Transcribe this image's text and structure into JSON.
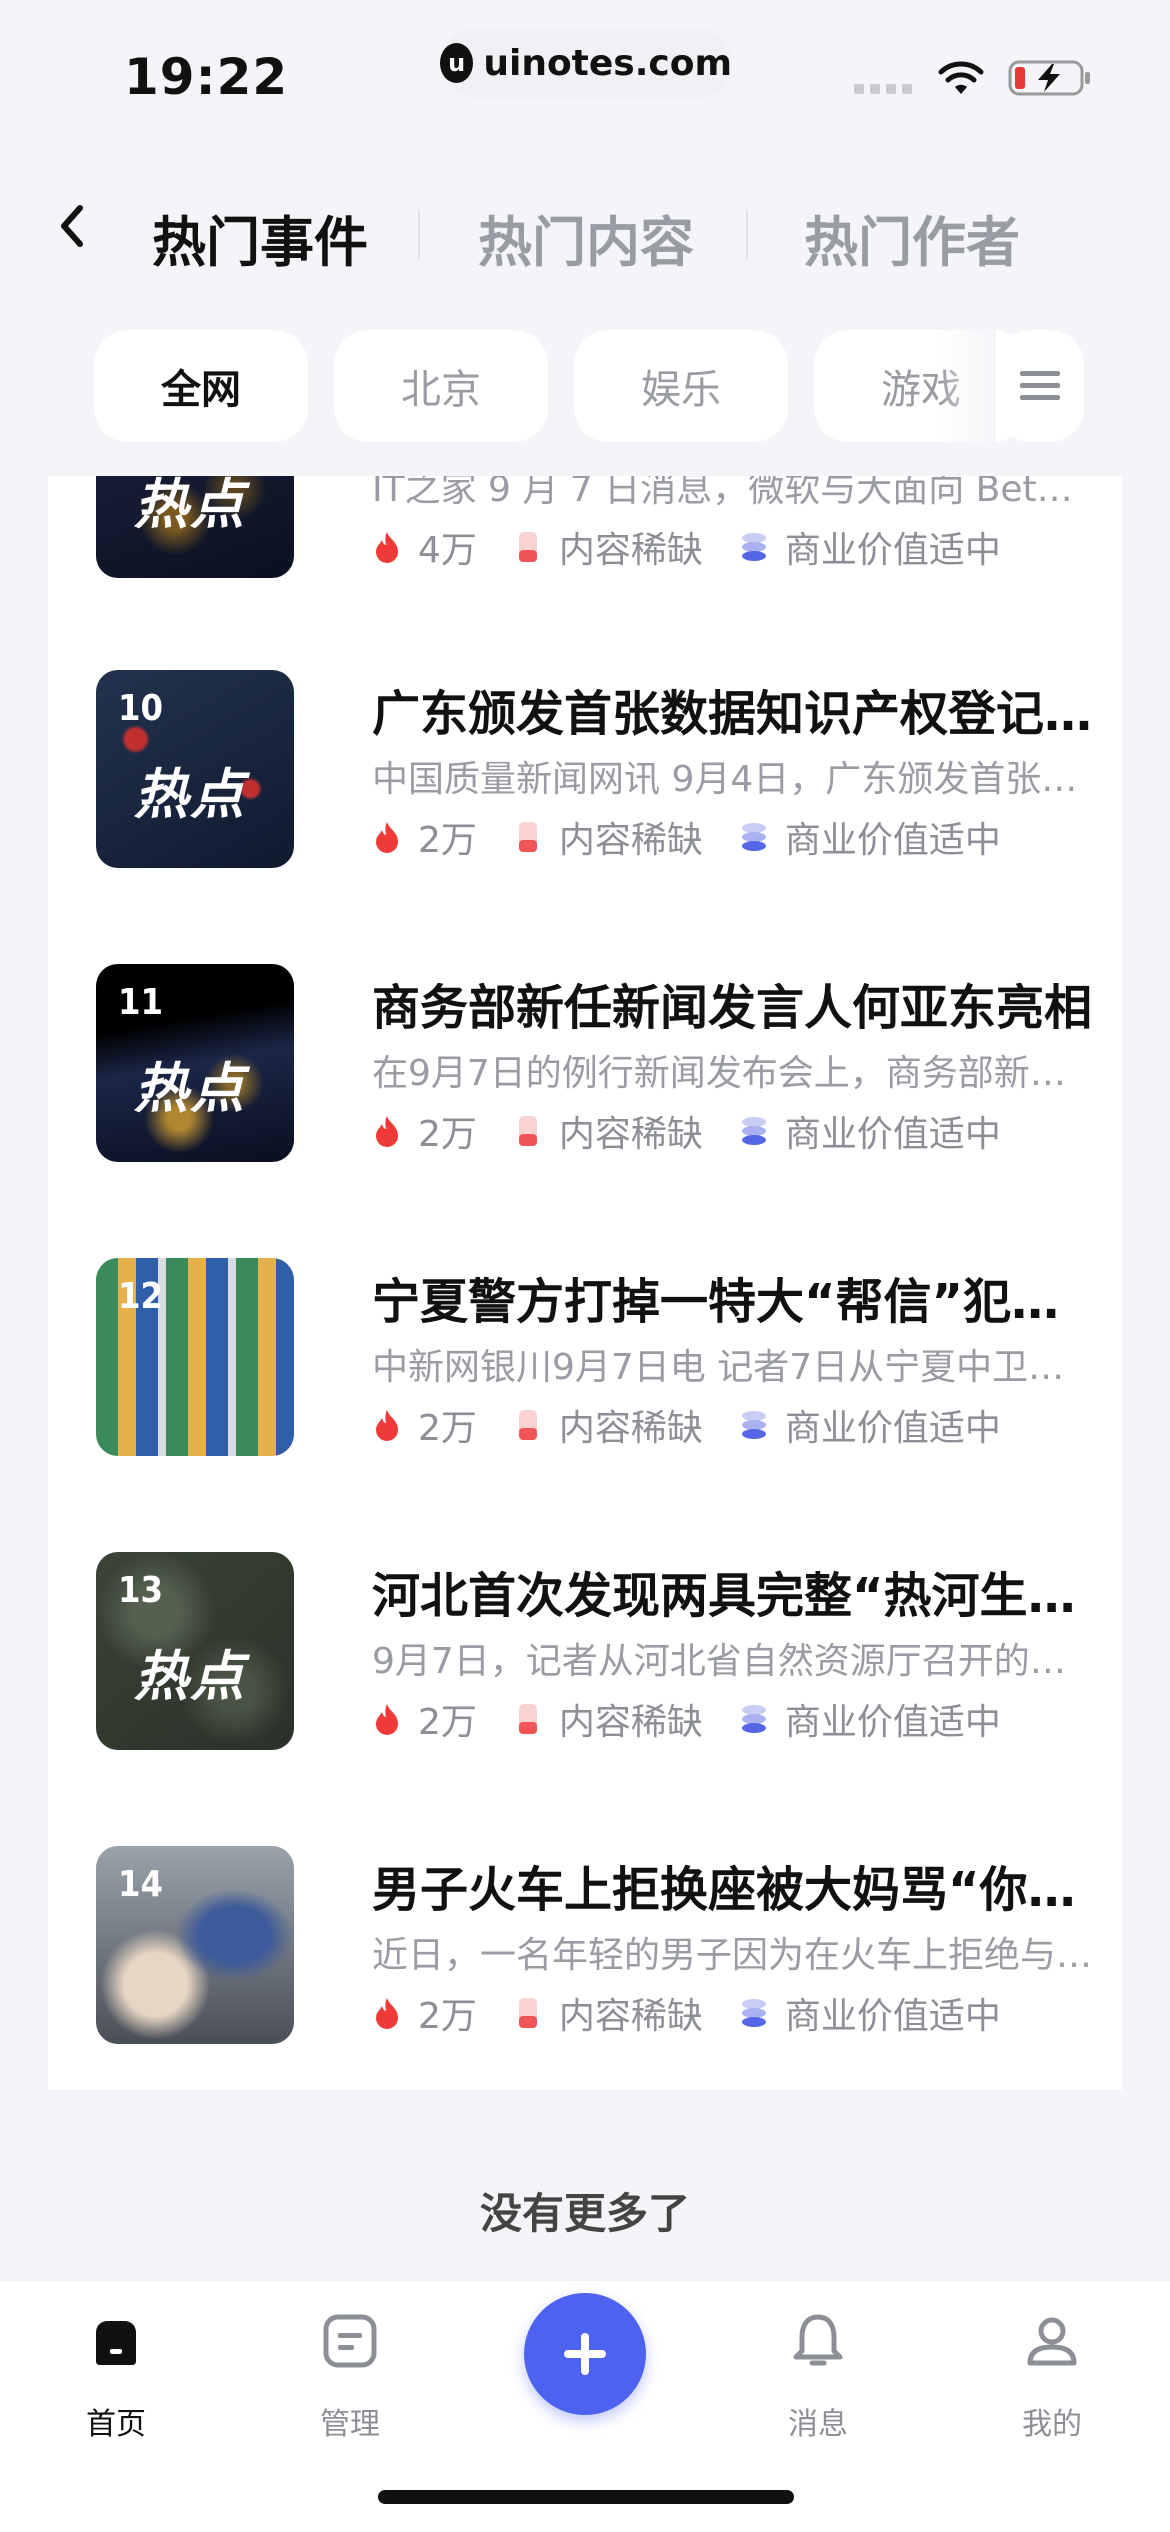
{
  "status_bar": {
    "time": "19:22",
    "url": "uinotes.com"
  },
  "tabs": [
    {
      "label": "热门事件",
      "active": true
    },
    {
      "label": "热门内容",
      "active": false
    },
    {
      "label": "热门作者",
      "active": false
    }
  ],
  "chips": [
    {
      "label": "全网",
      "active": true
    },
    {
      "label": "北京",
      "active": false
    },
    {
      "label": "娱乐",
      "active": false
    },
    {
      "label": "游戏",
      "active": false
    }
  ],
  "items": [
    {
      "rank": "",
      "title": "",
      "desc": "IT之家 9 月 7 日消息，微软与大面向 Beta…",
      "heat": "4万",
      "scarcity": "内容稀缺",
      "value": "商业价值适中",
      "thumb_style": "city"
    },
    {
      "rank": "10",
      "title": "广东颁发首张数据知识产权登记…",
      "desc": "中国质量新闻网讯 9月4日，广东颁发首张“…",
      "heat": "2万",
      "scarcity": "内容稀缺",
      "value": "商业价值适中",
      "thumb_style": "map"
    },
    {
      "rank": "11",
      "title": "商务部新任新闻发言人何亚东亮相",
      "desc": "在9月7日的例行新闻发布会上，商务部新任…",
      "heat": "2万",
      "scarcity": "内容稀缺",
      "value": "商业价值适中",
      "thumb_style": "city"
    },
    {
      "rank": "12",
      "title": "宁夏警方打掉一特大“帮信”犯罪…",
      "desc": "中新网银川9月7日电 记者7日从宁夏中卫市…",
      "heat": "2万",
      "scarcity": "内容稀缺",
      "value": "商业价值适中",
      "thumb_style": "cards"
    },
    {
      "rank": "13",
      "title": "河北首次发现两具完整“热河生物…",
      "desc": "9月7日，记者从河北省自然资源厅召开的新…",
      "heat": "2万",
      "scarcity": "内容稀缺",
      "value": "商业价值适中",
      "thumb_style": "terrain"
    },
    {
      "rank": "14",
      "title": "男子火车上拒换座被大妈骂“你妈…",
      "desc": "近日，一名年轻的男子因为在火车上拒绝与…",
      "heat": "2万",
      "scarcity": "内容稀缺",
      "value": "商业价值适中",
      "thumb_style": "photo"
    }
  ],
  "thumb_overlay": "热点",
  "footer_text": "没有更多了",
  "tabbar": [
    {
      "label": "首页",
      "icon": "home-icon",
      "active": true
    },
    {
      "label": "管理",
      "icon": "manage-icon",
      "active": false
    },
    {
      "label": "",
      "icon": "plus-icon",
      "active": false
    },
    {
      "label": "消息",
      "icon": "bell-icon",
      "active": false
    },
    {
      "label": "我的",
      "icon": "profile-icon",
      "active": false
    }
  ],
  "colors": {
    "accent": "#4d63f0",
    "fire": "#f03a3a",
    "background": "#f4f5f8"
  }
}
